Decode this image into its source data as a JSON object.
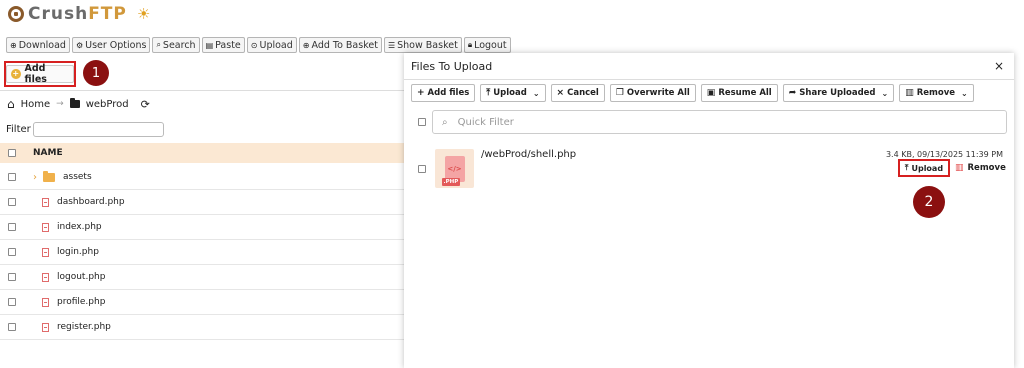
{
  "app": {
    "brand_part1": "Crush",
    "brand_part2": "FTP"
  },
  "toolbar": [
    {
      "icon": "plus-circle",
      "label": "Download"
    },
    {
      "icon": "gear",
      "label": "User Options"
    },
    {
      "icon": "search",
      "label": "Search"
    },
    {
      "icon": "clipboard",
      "label": "Paste"
    },
    {
      "icon": "upload-circle",
      "label": "Upload"
    },
    {
      "icon": "plus-circle",
      "label": "Add To Basket"
    },
    {
      "icon": "list",
      "label": "Show Basket"
    },
    {
      "icon": "lock",
      "label": "Logout"
    }
  ],
  "left_pane": {
    "add_files_label": "Add files",
    "marker1": "1",
    "breadcrumb": {
      "home": "Home",
      "folder": "webProd"
    },
    "filter_label": "Filter",
    "column_name": "NAME",
    "items": [
      {
        "type": "folder",
        "name": "assets"
      },
      {
        "type": "file",
        "name": "dashboard.php"
      },
      {
        "type": "file",
        "name": "index.php"
      },
      {
        "type": "file",
        "name": "login.php"
      },
      {
        "type": "file",
        "name": "logout.php"
      },
      {
        "type": "file",
        "name": "profile.php"
      },
      {
        "type": "file",
        "name": "register.php"
      }
    ]
  },
  "modal": {
    "title": "Files To Upload",
    "close": "×",
    "buttons": {
      "add_files": "Add files",
      "upload": "Upload",
      "cancel": "Cancel",
      "overwrite_all": "Overwrite All",
      "resume_all": "Resume All",
      "share_uploaded": "Share Uploaded",
      "remove": "Remove"
    },
    "quick_filter_placeholder": "Quick Filter",
    "file": {
      "path": "/webProd/shell.php",
      "thumb_badge": ".PHP",
      "thumb_code": "</>",
      "meta": "3.4 KB, 09/13/2025 11:39 PM",
      "upload_label": "Upload",
      "remove_label": "Remove"
    },
    "marker2": "2"
  },
  "colors": {
    "brand_grey": "#6b6b6b",
    "brand_orange": "#d1983b",
    "highlight_red": "#d62020",
    "marker_red": "#8b1010",
    "header_row": "#fbe8d3"
  }
}
